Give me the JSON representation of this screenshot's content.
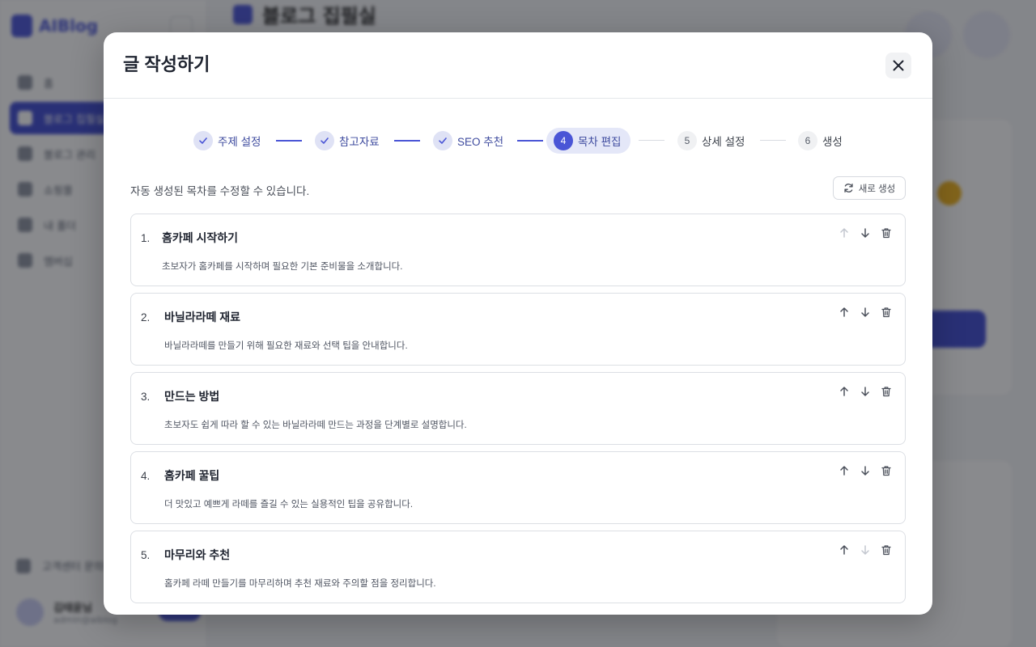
{
  "background": {
    "brand_name": "AIBlog",
    "page_title": "블로그 집필실",
    "nav_items": [
      "홈",
      "블로그 집필실",
      "블로그 관리",
      "쇼핑몰",
      "내 폴더",
      "멤버십"
    ],
    "footer_link": "고객센터 문의하기",
    "user_name": "김태윤님",
    "user_sub": "admin@aiblog"
  },
  "modal": {
    "title": "글 작성하기",
    "close_icon": "close-icon"
  },
  "stepper": [
    {
      "number": "1",
      "label": "주제 설정",
      "state": "done"
    },
    {
      "number": "2",
      "label": "참고자료",
      "state": "done"
    },
    {
      "number": "3",
      "label": "SEO 추천",
      "state": "done"
    },
    {
      "number": "4",
      "label": "목차 편집",
      "state": "current"
    },
    {
      "number": "5",
      "label": "상세 설정",
      "state": "todo"
    },
    {
      "number": "6",
      "label": "생성",
      "state": "todo"
    }
  ],
  "instructions": "자동 생성된 목차를 수정할 수 있습니다.",
  "regenerate_button": "새로 생성",
  "toc": [
    {
      "number": "1.",
      "title": "홈카페 시작하기",
      "desc": "초보자가 홈카페를 시작하며 필요한 기본 준비물을 소개합니다.",
      "up_enabled": false,
      "down_enabled": true
    },
    {
      "number": "2.",
      "title": "바닐라라떼 재료",
      "desc": "바닐라라떼를 만들기 위해 필요한 재료와 선택 팁을 안내합니다.",
      "up_enabled": true,
      "down_enabled": true
    },
    {
      "number": "3.",
      "title": "만드는 방법",
      "desc": "초보자도 쉽게 따라 할 수 있는 바닐라라떼 만드는 과정을 단계별로 설명합니다.",
      "up_enabled": true,
      "down_enabled": true
    },
    {
      "number": "4.",
      "title": "홈카페 꿀팁",
      "desc": "더 맛있고 예쁘게 라떼를 즐길 수 있는 실용적인 팁을 공유합니다.",
      "up_enabled": true,
      "down_enabled": true
    },
    {
      "number": "5.",
      "title": "마무리와 추천",
      "desc": "홈카페 라떼 만들기를 마무리하며 추천 재료와 주의할 점을 정리합니다.",
      "up_enabled": true,
      "down_enabled": false
    }
  ],
  "colors": {
    "accent": "#4a55d6",
    "step_done_bg": "#dfe2f5",
    "disabled_icon": "#c3c7cf",
    "enabled_icon": "#4b505b"
  }
}
